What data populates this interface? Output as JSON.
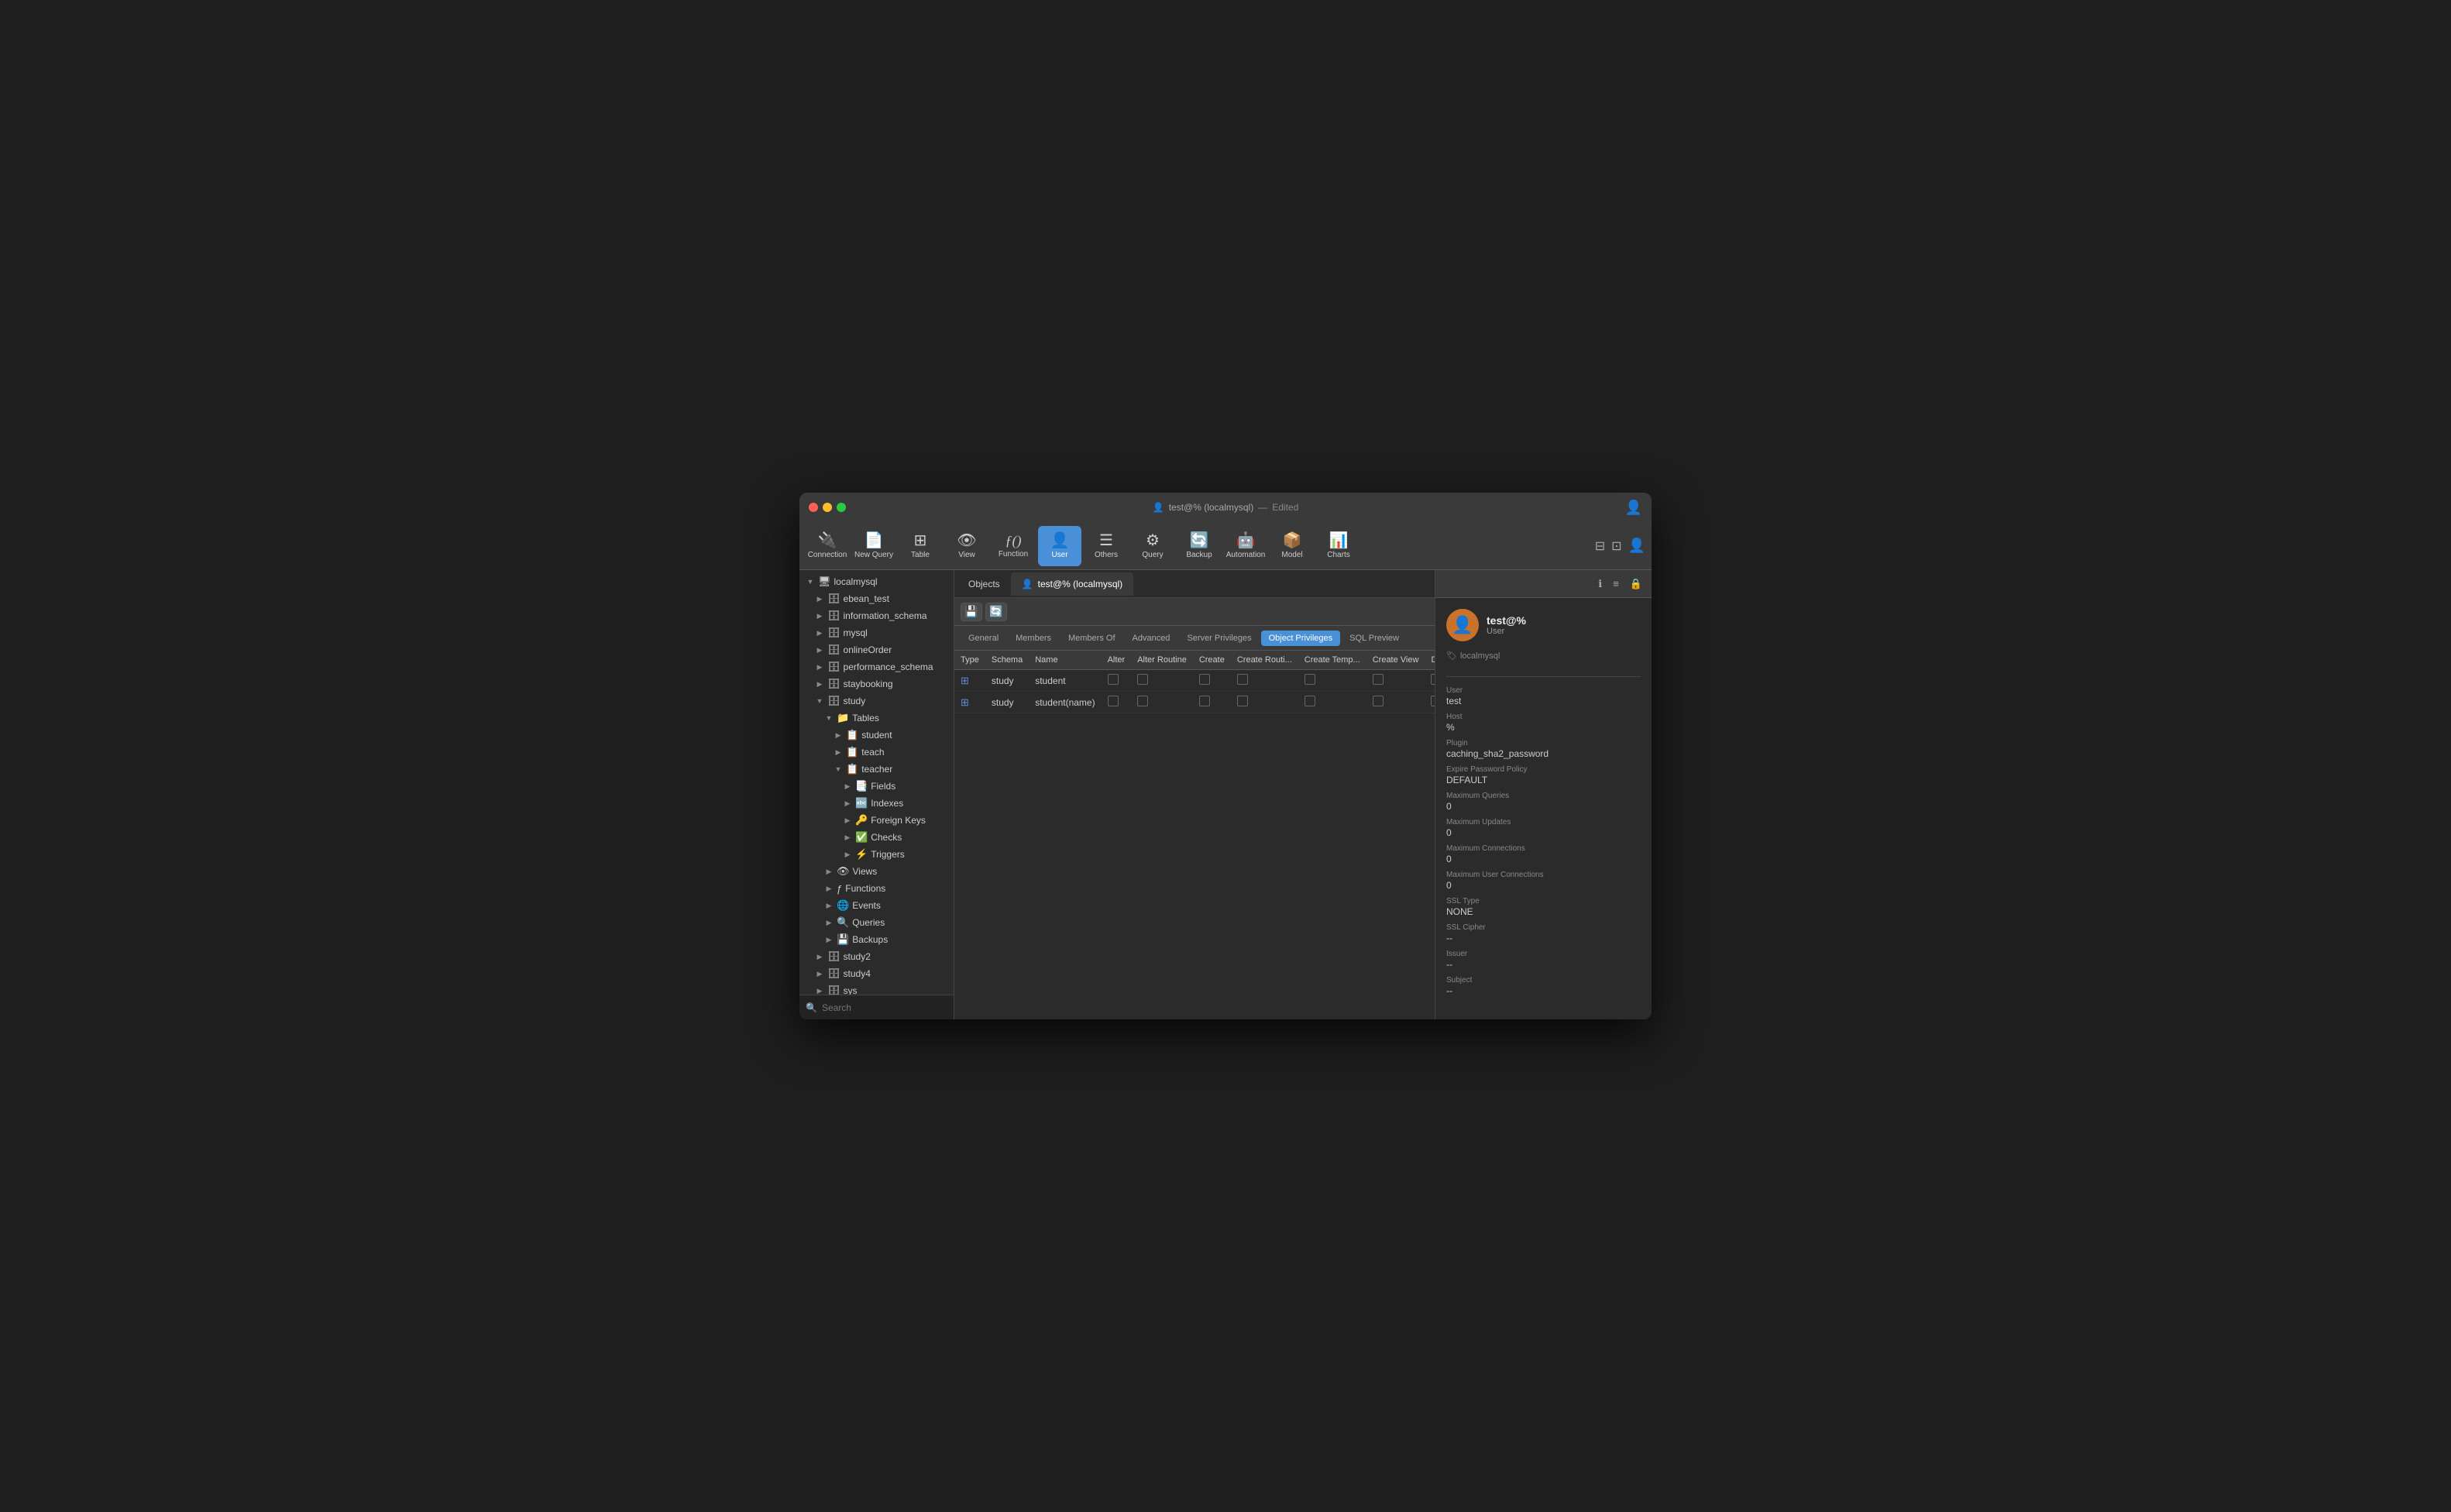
{
  "window": {
    "title": "test@% (localmysql)",
    "subtitle": "Edited",
    "traffic_lights": [
      "red",
      "yellow",
      "green"
    ]
  },
  "toolbar": {
    "items": [
      {
        "id": "connection",
        "label": "Connection",
        "icon": "🔌"
      },
      {
        "id": "new-query",
        "label": "New Query",
        "icon": "📄"
      },
      {
        "id": "table",
        "label": "Table",
        "icon": "⊞"
      },
      {
        "id": "view",
        "label": "View",
        "icon": "👁"
      },
      {
        "id": "function",
        "label": "Function",
        "icon": "ƒ"
      },
      {
        "id": "user",
        "label": "User",
        "icon": "👤",
        "active": true
      },
      {
        "id": "others",
        "label": "Others",
        "icon": "☰"
      },
      {
        "id": "query",
        "label": "Query",
        "icon": "⚙"
      },
      {
        "id": "backup",
        "label": "Backup",
        "icon": "🔄"
      },
      {
        "id": "automation",
        "label": "Automation",
        "icon": "🤖"
      },
      {
        "id": "model",
        "label": "Model",
        "icon": "📦"
      },
      {
        "id": "charts",
        "label": "Charts",
        "icon": "📊"
      }
    ],
    "view_label": "View"
  },
  "sidebar": {
    "items": [
      {
        "id": "localmysql",
        "label": "localmysql",
        "level": 0,
        "expanded": true,
        "type": "server"
      },
      {
        "id": "ebean_test",
        "label": "ebean_test",
        "level": 1,
        "expanded": false,
        "type": "db"
      },
      {
        "id": "information_schema",
        "label": "information_schema",
        "level": 1,
        "expanded": false,
        "type": "db"
      },
      {
        "id": "mysql",
        "label": "mysql",
        "level": 1,
        "expanded": false,
        "type": "db"
      },
      {
        "id": "onlineorder",
        "label": "onlineOrder",
        "level": 1,
        "expanded": false,
        "type": "db"
      },
      {
        "id": "performance_schema",
        "label": "performance_schema",
        "level": 1,
        "expanded": false,
        "type": "db"
      },
      {
        "id": "staybooking",
        "label": "staybooking",
        "level": 1,
        "expanded": false,
        "type": "db"
      },
      {
        "id": "study",
        "label": "study",
        "level": 1,
        "expanded": true,
        "type": "db"
      },
      {
        "id": "tables",
        "label": "Tables",
        "level": 2,
        "expanded": true,
        "type": "folder"
      },
      {
        "id": "student",
        "label": "student",
        "level": 3,
        "expanded": false,
        "type": "table"
      },
      {
        "id": "teach",
        "label": "teach",
        "level": 3,
        "expanded": false,
        "type": "table"
      },
      {
        "id": "teacher",
        "label": "teacher",
        "level": 3,
        "expanded": true,
        "type": "table"
      },
      {
        "id": "fields",
        "label": "Fields",
        "level": 4,
        "expanded": false,
        "type": "folder"
      },
      {
        "id": "indexes",
        "label": "Indexes",
        "level": 4,
        "expanded": false,
        "type": "folder"
      },
      {
        "id": "foreign-keys",
        "label": "Foreign Keys",
        "level": 4,
        "expanded": false,
        "type": "folder"
      },
      {
        "id": "checks",
        "label": "Checks",
        "level": 4,
        "expanded": false,
        "type": "folder"
      },
      {
        "id": "triggers",
        "label": "Triggers",
        "level": 4,
        "expanded": false,
        "type": "folder"
      },
      {
        "id": "views",
        "label": "Views",
        "level": 2,
        "expanded": false,
        "type": "folder"
      },
      {
        "id": "functions",
        "label": "Functions",
        "level": 2,
        "expanded": false,
        "type": "folder"
      },
      {
        "id": "events",
        "label": "Events",
        "level": 2,
        "expanded": false,
        "type": "folder"
      },
      {
        "id": "queries",
        "label": "Queries",
        "level": 2,
        "expanded": false,
        "type": "folder"
      },
      {
        "id": "backups",
        "label": "Backups",
        "level": 2,
        "expanded": false,
        "type": "folder"
      },
      {
        "id": "study2",
        "label": "study2",
        "level": 1,
        "expanded": false,
        "type": "db"
      },
      {
        "id": "study4",
        "label": "study4",
        "level": 1,
        "expanded": false,
        "type": "db"
      },
      {
        "id": "sys",
        "label": "sys",
        "level": 1,
        "expanded": false,
        "type": "db"
      }
    ],
    "search_placeholder": "Search"
  },
  "tabs": [
    {
      "id": "objects",
      "label": "Objects",
      "active": false
    },
    {
      "id": "user-tab",
      "label": "test@% (localmysql)",
      "active": true,
      "user_icon": true
    }
  ],
  "sub_toolbar": {
    "save_icon": "💾",
    "refresh_icon": "🔄"
  },
  "nav_tabs": [
    {
      "id": "general",
      "label": "General",
      "active": false
    },
    {
      "id": "members",
      "label": "Members",
      "active": false
    },
    {
      "id": "members-of",
      "label": "Members Of",
      "active": false
    },
    {
      "id": "advanced",
      "label": "Advanced",
      "active": false
    },
    {
      "id": "server-privileges",
      "label": "Server Privileges",
      "active": false
    },
    {
      "id": "object-privileges",
      "label": "Object Privileges",
      "active": true
    },
    {
      "id": "sql-preview",
      "label": "SQL Preview",
      "active": false
    }
  ],
  "table": {
    "columns": [
      "Type",
      "Schema",
      "Name",
      "Alter",
      "Alter Routine",
      "Create",
      "Create Routi...",
      "Create Temp...",
      "Create View",
      "Delete"
    ],
    "rows": [
      {
        "type": "table",
        "schema": "study",
        "name": "student",
        "alter": false,
        "alter_routine": false,
        "create": false,
        "create_routine": false,
        "create_temp": false,
        "create_view": false,
        "delete": false
      },
      {
        "type": "table",
        "schema": "study",
        "name": "student(name)",
        "alter": false,
        "alter_routine": false,
        "create": false,
        "create_routine": false,
        "create_temp": false,
        "create_view": false,
        "delete": false
      }
    ]
  },
  "right_panel": {
    "user_name": "test@%",
    "user_role": "User",
    "connection": "localmysql",
    "props": [
      {
        "key": "User",
        "val": "test"
      },
      {
        "key": "Host",
        "val": "%"
      },
      {
        "key": "Plugin",
        "val": "caching_sha2_password"
      },
      {
        "key": "Expire Password Policy",
        "val": "DEFAULT"
      },
      {
        "key": "Maximum Queries",
        "val": "0"
      },
      {
        "key": "Maximum Updates",
        "val": "0"
      },
      {
        "key": "Maximum Connections",
        "val": "0"
      },
      {
        "key": "Maximum User Connections",
        "val": "0"
      },
      {
        "key": "SSL Type",
        "val": "NONE"
      },
      {
        "key": "SSL Cipher",
        "val": "--"
      },
      {
        "key": "Issuer",
        "val": "--"
      },
      {
        "key": "Subject",
        "val": "--"
      }
    ]
  }
}
